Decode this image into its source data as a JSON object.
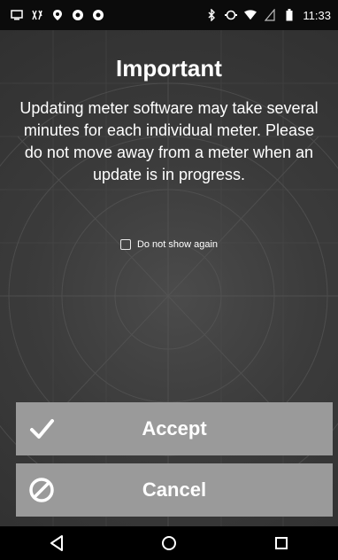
{
  "status_bar": {
    "time": "11:33",
    "left_icons": [
      "screen-icon",
      "voicemail-icon",
      "location-icon",
      "photo-icon",
      "photo-icon"
    ],
    "right_icons": [
      "bluetooth-icon",
      "sync-icon",
      "wifi-icon",
      "signal-icon",
      "battery-icon"
    ]
  },
  "dialog": {
    "title": "Important",
    "message": "Updating meter software may take several minutes for each individual meter. Please do not move away from a meter when an update is in progress.",
    "checkbox": {
      "label": "Do not show again",
      "checked": false
    }
  },
  "buttons": {
    "accept": "Accept",
    "cancel": "Cancel"
  },
  "nav": [
    "back-icon",
    "home-icon",
    "recents-icon"
  ],
  "colors": {
    "background": "#3a3a3a",
    "button": "#9a9a9a",
    "status_bar": "#0b0b0b"
  }
}
